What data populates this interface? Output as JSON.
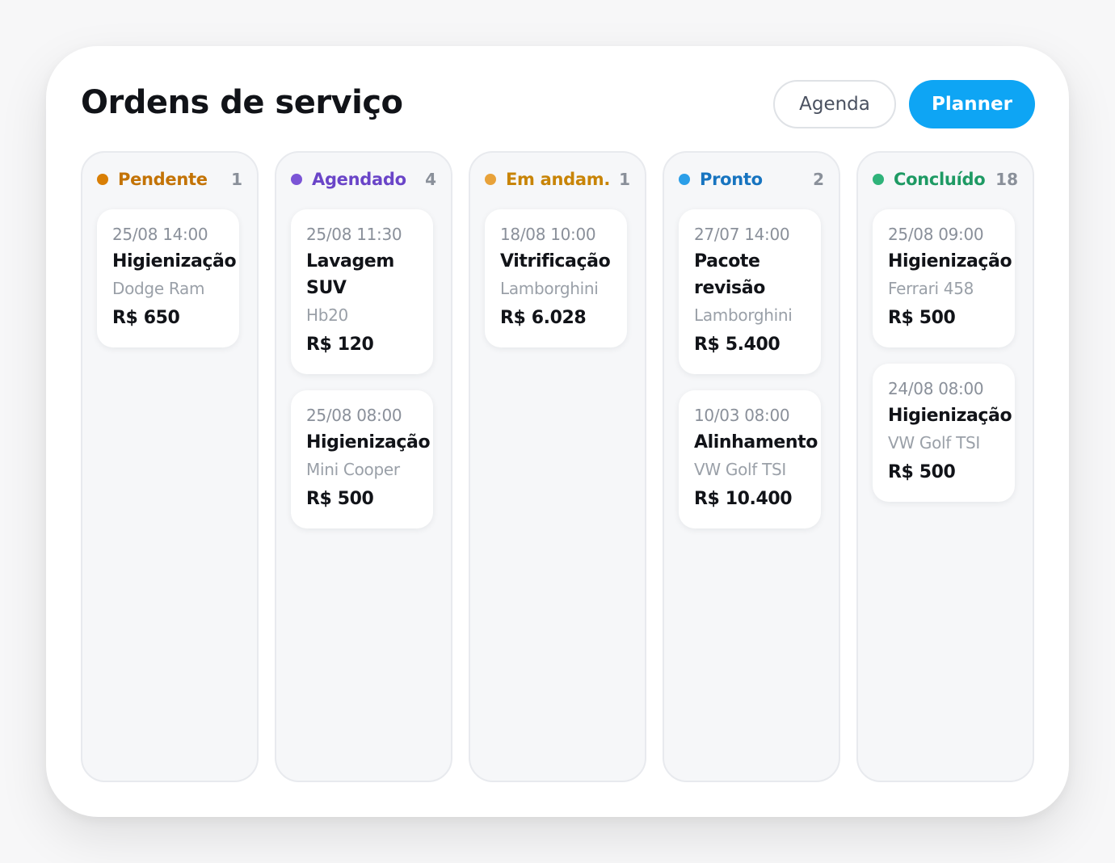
{
  "header": {
    "title": "Ordens de serviço",
    "agenda_label": "Agenda",
    "planner_label": "Planner"
  },
  "colors": {
    "pendente": "#d97f06",
    "agendado": "#7b55d6",
    "em_andamento": "#e8a23a",
    "em_andamento_text": "#c88407",
    "pronto": "#2b9ee8",
    "pronto_text": "#1774c0",
    "concluido": "#2fb37a",
    "concluido_text": "#1e9a64",
    "accent": "#0ea5f4"
  },
  "columns": [
    {
      "title": "Pendente",
      "count": "1",
      "cards": [
        {
          "date": "25/08 14:00",
          "service": "Higienização",
          "vehicle": "Dodge Ram",
          "price": "R$ 650"
        }
      ]
    },
    {
      "title": "Agendado",
      "count": "4",
      "cards": [
        {
          "date": "25/08 11:30",
          "service": "Lavagem SUV",
          "vehicle": "Hb20",
          "price": "R$ 120"
        },
        {
          "date": "25/08 08:00",
          "service": "Higienização",
          "vehicle": "Mini Cooper",
          "price": "R$ 500"
        }
      ]
    },
    {
      "title": "Em andam.",
      "count": "1",
      "cards": [
        {
          "date": "18/08 10:00",
          "service": "Vitrificação",
          "vehicle": "Lamborghini",
          "price": "R$ 6.028"
        }
      ]
    },
    {
      "title": "Pronto",
      "count": "2",
      "cards": [
        {
          "date": "27/07 14:00",
          "service": "Pacote revisão",
          "vehicle": "Lamborghini",
          "price": "R$ 5.400"
        },
        {
          "date": "10/03 08:00",
          "service": "Alinhamento",
          "vehicle": "VW Golf TSI",
          "price": "R$ 10.400"
        }
      ]
    },
    {
      "title": "Concluído",
      "count": "18",
      "cards": [
        {
          "date": "25/08 09:00",
          "service": "Higienização",
          "vehicle": "Ferrari 458",
          "price": "R$ 500"
        },
        {
          "date": "24/08 08:00",
          "service": "Higienização",
          "vehicle": "VW Golf TSI",
          "price": "R$ 500"
        }
      ]
    }
  ]
}
